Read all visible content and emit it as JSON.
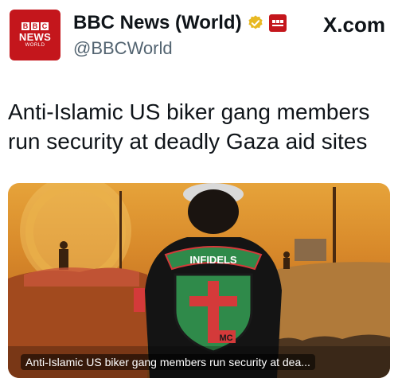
{
  "account": {
    "logo_bbc_letters": [
      "B",
      "B",
      "C"
    ],
    "logo_news": "NEWS",
    "logo_world": "WORLD",
    "display_name": "BBC News (World)",
    "handle": "@BBCWorld",
    "verified_badge_icon": "gold-verified-check-icon",
    "affiliate_icon": "bbc-news-mini-logo-icon"
  },
  "site": {
    "label": "X.com"
  },
  "post": {
    "headline": "Anti-Islamic US biker gang members run security at deadly Gaza aid sites"
  },
  "media": {
    "patch_top": "INFIDELS",
    "patch_small": "MC",
    "caption": "Anti-Islamic US biker gang members run security at dea..."
  },
  "colors": {
    "bbc_red": "#c4161c",
    "verified_gold": "#e8b923",
    "handle_gray": "#536471"
  }
}
